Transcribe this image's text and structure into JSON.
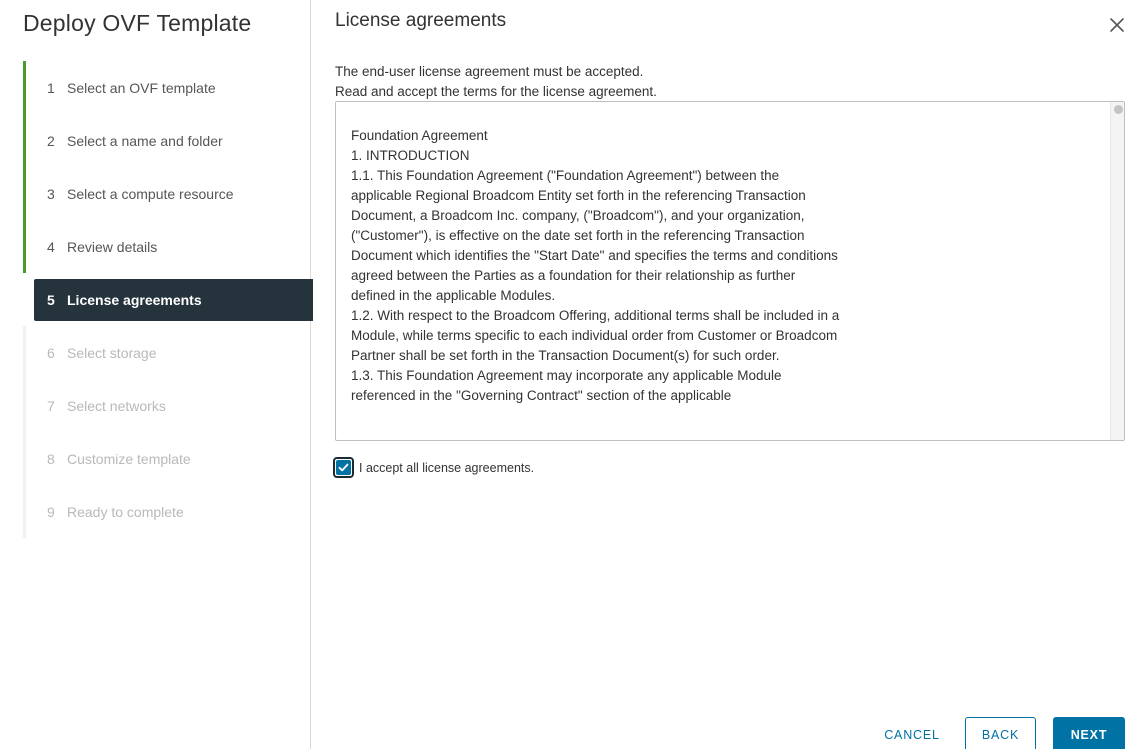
{
  "wizard": {
    "title": "Deploy OVF Template",
    "steps": [
      {
        "num": "1",
        "label": "Select an OVF template",
        "state": "done"
      },
      {
        "num": "2",
        "label": "Select a name and folder",
        "state": "done"
      },
      {
        "num": "3",
        "label": "Select a compute resource",
        "state": "done"
      },
      {
        "num": "4",
        "label": "Review details",
        "state": "done"
      },
      {
        "num": "5",
        "label": "License agreements",
        "state": "active"
      },
      {
        "num": "6",
        "label": "Select storage",
        "state": "todo"
      },
      {
        "num": "7",
        "label": "Select networks",
        "state": "todo"
      },
      {
        "num": "8",
        "label": "Customize template",
        "state": "todo"
      },
      {
        "num": "9",
        "label": "Ready to complete",
        "state": "todo"
      }
    ]
  },
  "main": {
    "title": "License agreements",
    "intro_line1": "The end-user license agreement must be accepted.",
    "intro_line2": "Read and accept the terms for the license agreement.",
    "eula_text": "Foundation Agreement\n1. INTRODUCTION\n1.1. This Foundation Agreement (\"Foundation Agreement\") between the applicable Regional Broadcom Entity set forth in the referencing Transaction Document, a Broadcom Inc. company, (\"Broadcom\"), and your organization, (\"Customer\"), is effective on the date set forth in the referencing Transaction Document which identifies the \"Start Date\" and specifies the terms and conditions agreed between the Parties as a foundation for their relationship as further defined in the applicable Modules.\n1.2. With respect to the Broadcom Offering, additional terms shall be included in a Module, while terms specific to each individual order from Customer or Broadcom Partner shall be set forth in the Transaction Document(s) for such order.\n1.3. This Foundation Agreement may incorporate any applicable Module referenced in the \"Governing Contract\" section of the applicable",
    "accept_label": "I accept all license agreements.",
    "accept_checked": true
  },
  "footer": {
    "cancel_label": "CANCEL",
    "back_label": "BACK",
    "next_label": "NEXT"
  },
  "colors": {
    "accent": "#0072a3",
    "active_step_bg": "#25333d",
    "done_step_bar": "#4c9a2a"
  },
  "icons": {
    "close": "close-icon",
    "check": "check-icon"
  }
}
